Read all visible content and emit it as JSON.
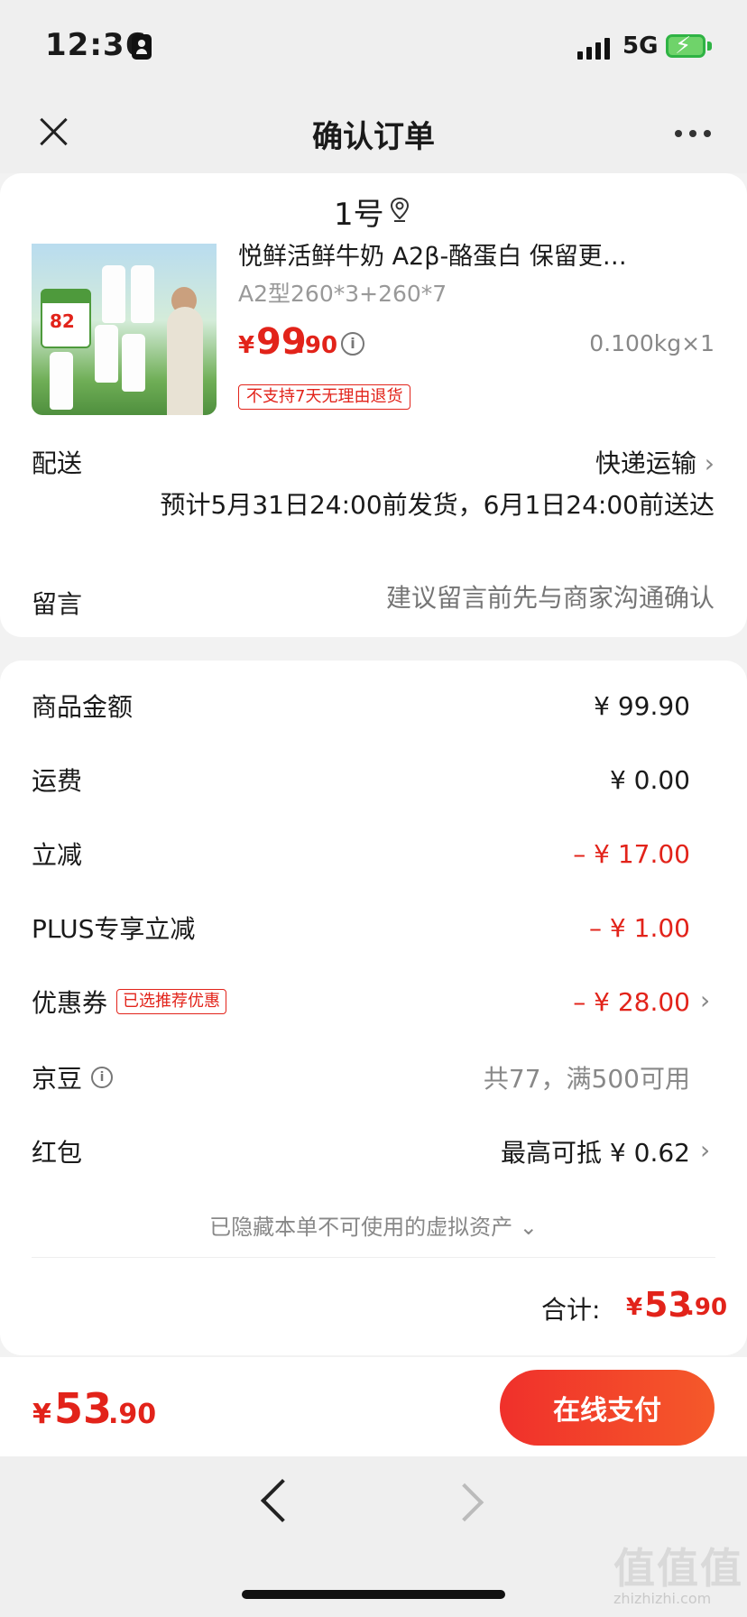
{
  "status_bar": {
    "time": "12:36",
    "network": "5G"
  },
  "header": {
    "title": "确认订单"
  },
  "location": {
    "text": "1号"
  },
  "product": {
    "title": "悦鲜活鲜牛奶 A2β-酪蛋白 保留更…",
    "spec": "A2型260*3+260*7",
    "price_symbol": "¥",
    "price_int": "99",
    "price_dec": ".90",
    "weight_qty": "0.100kg×1",
    "return_policy": "不支持7天无理由退货",
    "image_badge_number": "82"
  },
  "delivery": {
    "label": "配送",
    "method": "快递运输",
    "estimate": "预计5月31日24:00前发货，6月1日24:00前送达"
  },
  "message": {
    "label": "留言",
    "placeholder": "建议留言前先与商家沟通确认"
  },
  "summary": {
    "rows": [
      {
        "label": "商品金额",
        "value": "¥ 99.90"
      },
      {
        "label": "运费",
        "value": "¥ 0.00"
      },
      {
        "label": "立减",
        "value": "– ¥ 17.00"
      },
      {
        "label": "PLUS专享立减",
        "value": "– ¥ 1.00"
      },
      {
        "label": "优惠券",
        "tag": "已选推荐优惠",
        "value": "– ¥ 28.00"
      },
      {
        "label": "京豆",
        "value": "共77，满500可用"
      },
      {
        "label": "红包",
        "value": "最高可抵 ¥ 0.62"
      }
    ],
    "hidden_assets": "已隐藏本单不可使用的虚拟资产",
    "total_label": "合计:",
    "total_symbol": "¥",
    "total_int": "53",
    "total_dec": ".90"
  },
  "bottom_bar": {
    "symbol": "¥",
    "amount_int": "53",
    "amount_dec": ".90",
    "pay_label": "在线支付"
  },
  "watermark": {
    "main": "值值值",
    "sub": "zhizhizhi.com"
  },
  "colors": {
    "accent_red": "#e2231a",
    "pay_gradient_start": "#f0302b",
    "pay_gradient_end": "#f5592a"
  },
  "icons": [
    "close-icon",
    "more-icon",
    "location-pin-icon",
    "info-icon",
    "chevron-right-icon",
    "chevron-down-icon",
    "back-chevron-icon",
    "forward-chevron-icon"
  ]
}
